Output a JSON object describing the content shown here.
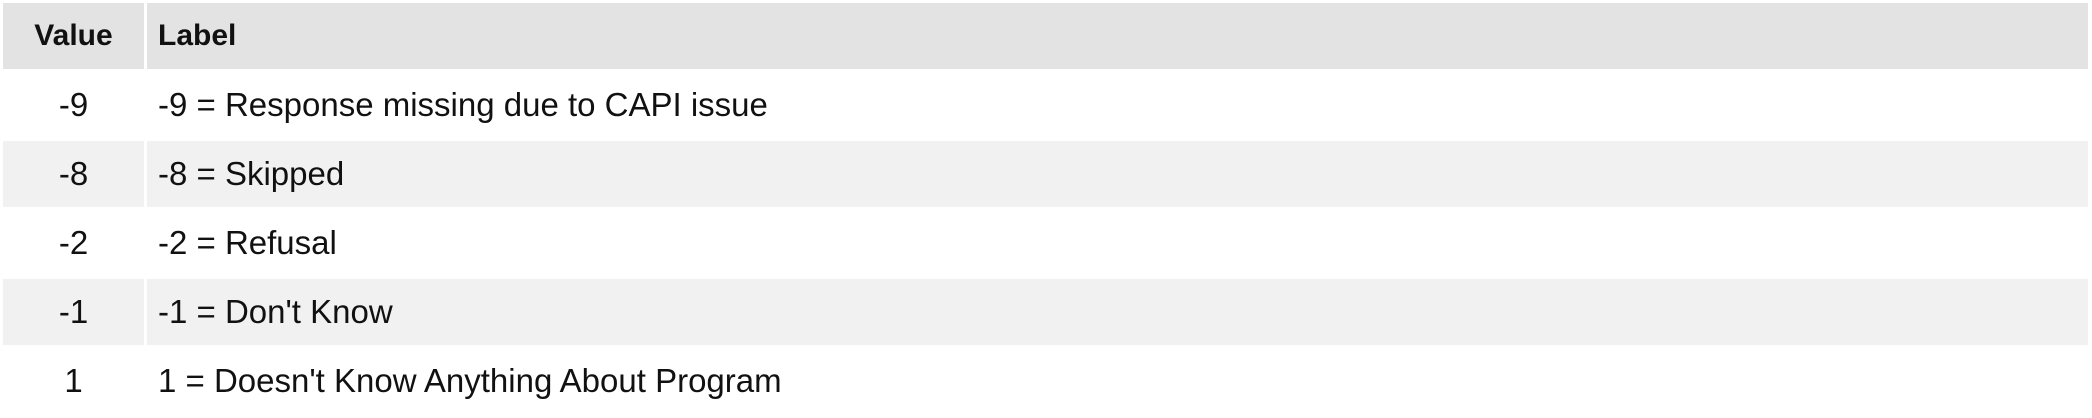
{
  "table": {
    "headers": {
      "value": "Value",
      "label": "Label"
    },
    "rows": [
      {
        "value": "-9",
        "label": "-9 = Response missing due to CAPI issue"
      },
      {
        "value": "-8",
        "label": "-8 = Skipped"
      },
      {
        "value": "-2",
        "label": "-2 = Refusal"
      },
      {
        "value": "-1",
        "label": "-1 = Don't Know"
      },
      {
        "value": "1",
        "label": "1 = Doesn't Know Anything About Program"
      }
    ]
  }
}
